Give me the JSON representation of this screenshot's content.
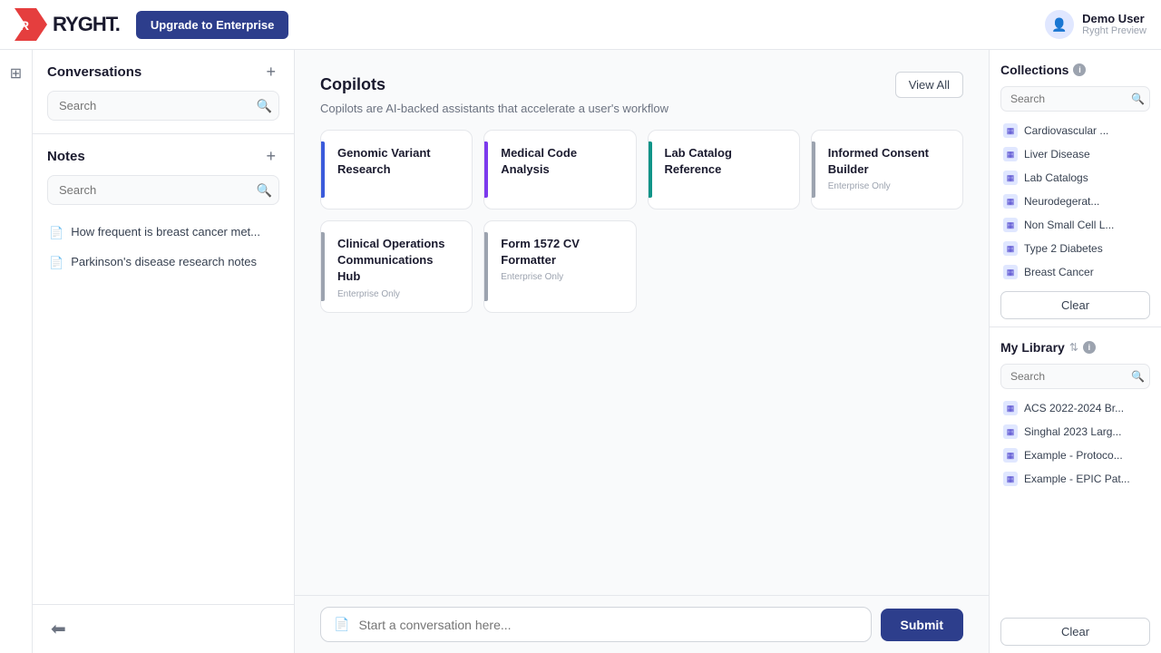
{
  "app": {
    "name": "RYGHT.",
    "upgrade_label": "Upgrade to Enterprise",
    "user_name": "Demo User",
    "user_subtitle": "Ryght Preview"
  },
  "conversations": {
    "title": "Conversations",
    "add_label": "+",
    "search_placeholder": "Search"
  },
  "notes": {
    "title": "Notes",
    "add_label": "+",
    "search_placeholder": "Search",
    "items": [
      {
        "label": "How frequent is breast cancer met..."
      },
      {
        "label": "Parkinson's disease research notes"
      }
    ]
  },
  "copilots": {
    "title": "Copilots",
    "subtitle": "Copilots are AI-backed assistants that accelerate a user's workflow",
    "view_all_label": "View All",
    "cards": [
      {
        "name": "Genomic Variant Research",
        "enterprise": false,
        "accent": "blue"
      },
      {
        "name": "Medical Code Analysis",
        "enterprise": false,
        "accent": "purple"
      },
      {
        "name": "Lab Catalog Reference",
        "enterprise": false,
        "accent": "teal"
      },
      {
        "name": "Informed Consent Builder",
        "enterprise": true,
        "accent": "gray"
      },
      {
        "name": "Clinical Operations Communications Hub",
        "enterprise": true,
        "accent": "gray"
      },
      {
        "name": "Form 1572 CV Formatter",
        "enterprise": true,
        "accent": "gray"
      }
    ],
    "enterprise_label": "Enterprise Only"
  },
  "chat": {
    "placeholder": "Start a conversation here...",
    "submit_label": "Submit"
  },
  "collections": {
    "title": "Collections",
    "search_placeholder": "Search",
    "items": [
      {
        "label": "Cardiovascular ..."
      },
      {
        "label": "Liver Disease"
      },
      {
        "label": "Lab Catalogs"
      },
      {
        "label": "Neurodegerat..."
      },
      {
        "label": "Non Small Cell L..."
      },
      {
        "label": "Type 2 Diabetes"
      },
      {
        "label": "Breast Cancer"
      }
    ],
    "clear_label": "Clear"
  },
  "my_library": {
    "title": "My Library",
    "search_placeholder": "Search",
    "items": [
      {
        "label": "ACS 2022-2024 Br..."
      },
      {
        "label": "Singhal 2023 Larg..."
      },
      {
        "label": "Example - Protoco..."
      },
      {
        "label": "Example - EPIC Pat..."
      }
    ],
    "clear_label": "Clear"
  },
  "icons": {
    "search": "🔍",
    "note": "📄",
    "info": "i",
    "collection": "▦",
    "chat": "💬",
    "sidebar_toggle": "⊞",
    "logout": "⬅",
    "plus": "+"
  }
}
